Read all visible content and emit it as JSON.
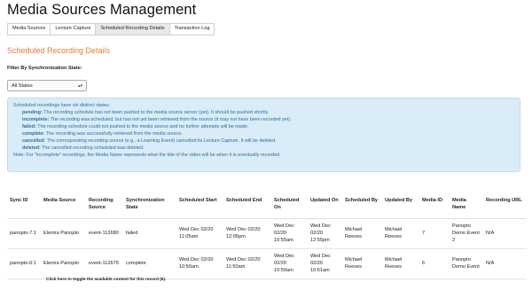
{
  "page": {
    "title": "Media Sources Management"
  },
  "tabs": [
    {
      "label": "Media Sources"
    },
    {
      "label": "Lecture Capture"
    },
    {
      "label": "Scheduled Recording Details"
    },
    {
      "label": "Transaction Log"
    }
  ],
  "section": {
    "title": "Scheduled Recording Details"
  },
  "filter": {
    "label": "Filter By Synchronization State:",
    "selected": "All States"
  },
  "info": {
    "intro": "Scheduled recordings have six distinct states:",
    "states": [
      {
        "name": "pending:",
        "text": " The recording schedule has not been pushed to the media source server (yet). It should be pushed shortly."
      },
      {
        "name": "incomplete:",
        "text": " The recording was scheduled, but has not yet been retrieved from the source (it may not have been recorded yet)."
      },
      {
        "name": "failed:",
        "text": " The recording schedule could not pushed to the media source and no further attempts will be made."
      },
      {
        "name": "complete:",
        "text": " The recording was successfully retrieved from the media source."
      },
      {
        "name": "cancelled:",
        "text": " The corresponding recording source (e.g., a Learning Event) cancelled its Lecture Capture. It will be deleted."
      },
      {
        "name": "deleted:",
        "text": " The cancelled recording scheduled was deleted."
      }
    ],
    "note": "Note: For \"incomplete\" recordings, the Media Name represents what the title of the video will be when it is eventually recorded."
  },
  "table": {
    "headers": [
      "Sync ID",
      "Media Source",
      "Recording Source",
      "Synchronization State",
      "Scheduled Start",
      "Scheduled End",
      "Scheduled On",
      "Updated On",
      "Scheduled By",
      "Updated By",
      "Media ID",
      "Media Name",
      "Recording URL"
    ],
    "rows": [
      [
        "panopto-7:1",
        "Elentra Panopto",
        "event-112680",
        "failed",
        "Wed Dec 02/20 11:05am",
        "Wed Dec 02/20 12:05pm",
        "Wed Dec 02/20 10:55am",
        "Wed Dec 02/20 12:55pm",
        "Michael Reeves",
        "Michael Reeves",
        "7",
        "Panopto Demo Event 2",
        "N/A"
      ],
      [
        "panopto-6:1",
        "Elentra Panopto",
        "event-112679",
        "complete",
        "Wed Dec 02/20 10:50am",
        "Wed Dec 02/20 11:50am",
        "Wed Dec 02/20 10:50am",
        "Wed Dec 02/20 10:51am",
        "Michael Reeves",
        "Michael Reeves",
        "6",
        "Panopto Demo Event",
        "N/A"
      ]
    ]
  },
  "footer": {
    "toggle_note": "Click here to toggle the available context for this record (6)."
  }
}
